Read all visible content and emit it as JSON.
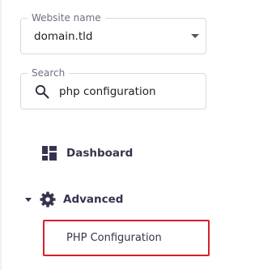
{
  "website_selector": {
    "label": "Website name",
    "value": "domain.tld"
  },
  "search": {
    "label": "Search",
    "value": "php configuration"
  },
  "nav": {
    "dashboard": {
      "label": "Dashboard",
      "icon": "dashboard-icon"
    },
    "advanced": {
      "label": "Advanced",
      "icon": "gear-icon",
      "expanded": true
    },
    "php_configuration": {
      "label": "PHP Configuration",
      "highlight_color": "#d6202b"
    }
  }
}
